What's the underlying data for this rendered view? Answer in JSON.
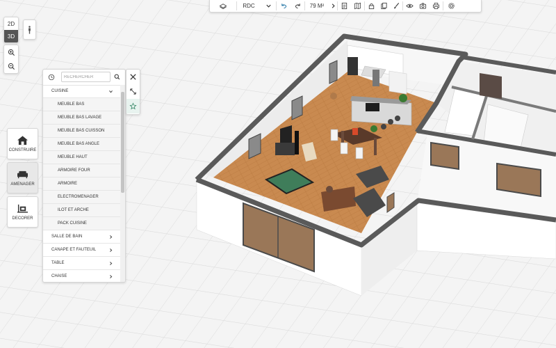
{
  "toolbar": {
    "level_label": "RDC",
    "area_label": "79 M²"
  },
  "view_toggle": {
    "mode_2d": "2D",
    "mode_3d": "3D",
    "active": "3D"
  },
  "tools": [
    {
      "label": "CONSTRUIRE",
      "icon": "house-icon"
    },
    {
      "label": "AMENAGER",
      "icon": "sofa-icon",
      "active": true
    },
    {
      "label": "DECORER",
      "icon": "decor-icon"
    }
  ],
  "catalog": {
    "search_placeholder": "RECHERCHER",
    "open_category": "CUISINE",
    "subitems": [
      "MEUBLE BAS",
      "MEUBLE BAS LAVAGE",
      "MEUBLE BAS CUISSON",
      "MEUBLE BAS ANGLE",
      "MEUBLE HAUT",
      "ARMOIRE FOUR",
      "ARMOIRE",
      "ELECTROMENAGER",
      "ILOT ET ARCHE",
      "PACK CUISINE"
    ],
    "categories": [
      "SALLE DE BAIN",
      "CANAPE ET FAUTEUIL",
      "TABLE",
      "CHAISE"
    ]
  },
  "colors": {
    "wall_top": "#5a5a5a",
    "wood_floor": "#c8894f",
    "grid_line": "#d9d9d9",
    "panel_border": "#d6d6d6",
    "accent_active": "#555555"
  }
}
